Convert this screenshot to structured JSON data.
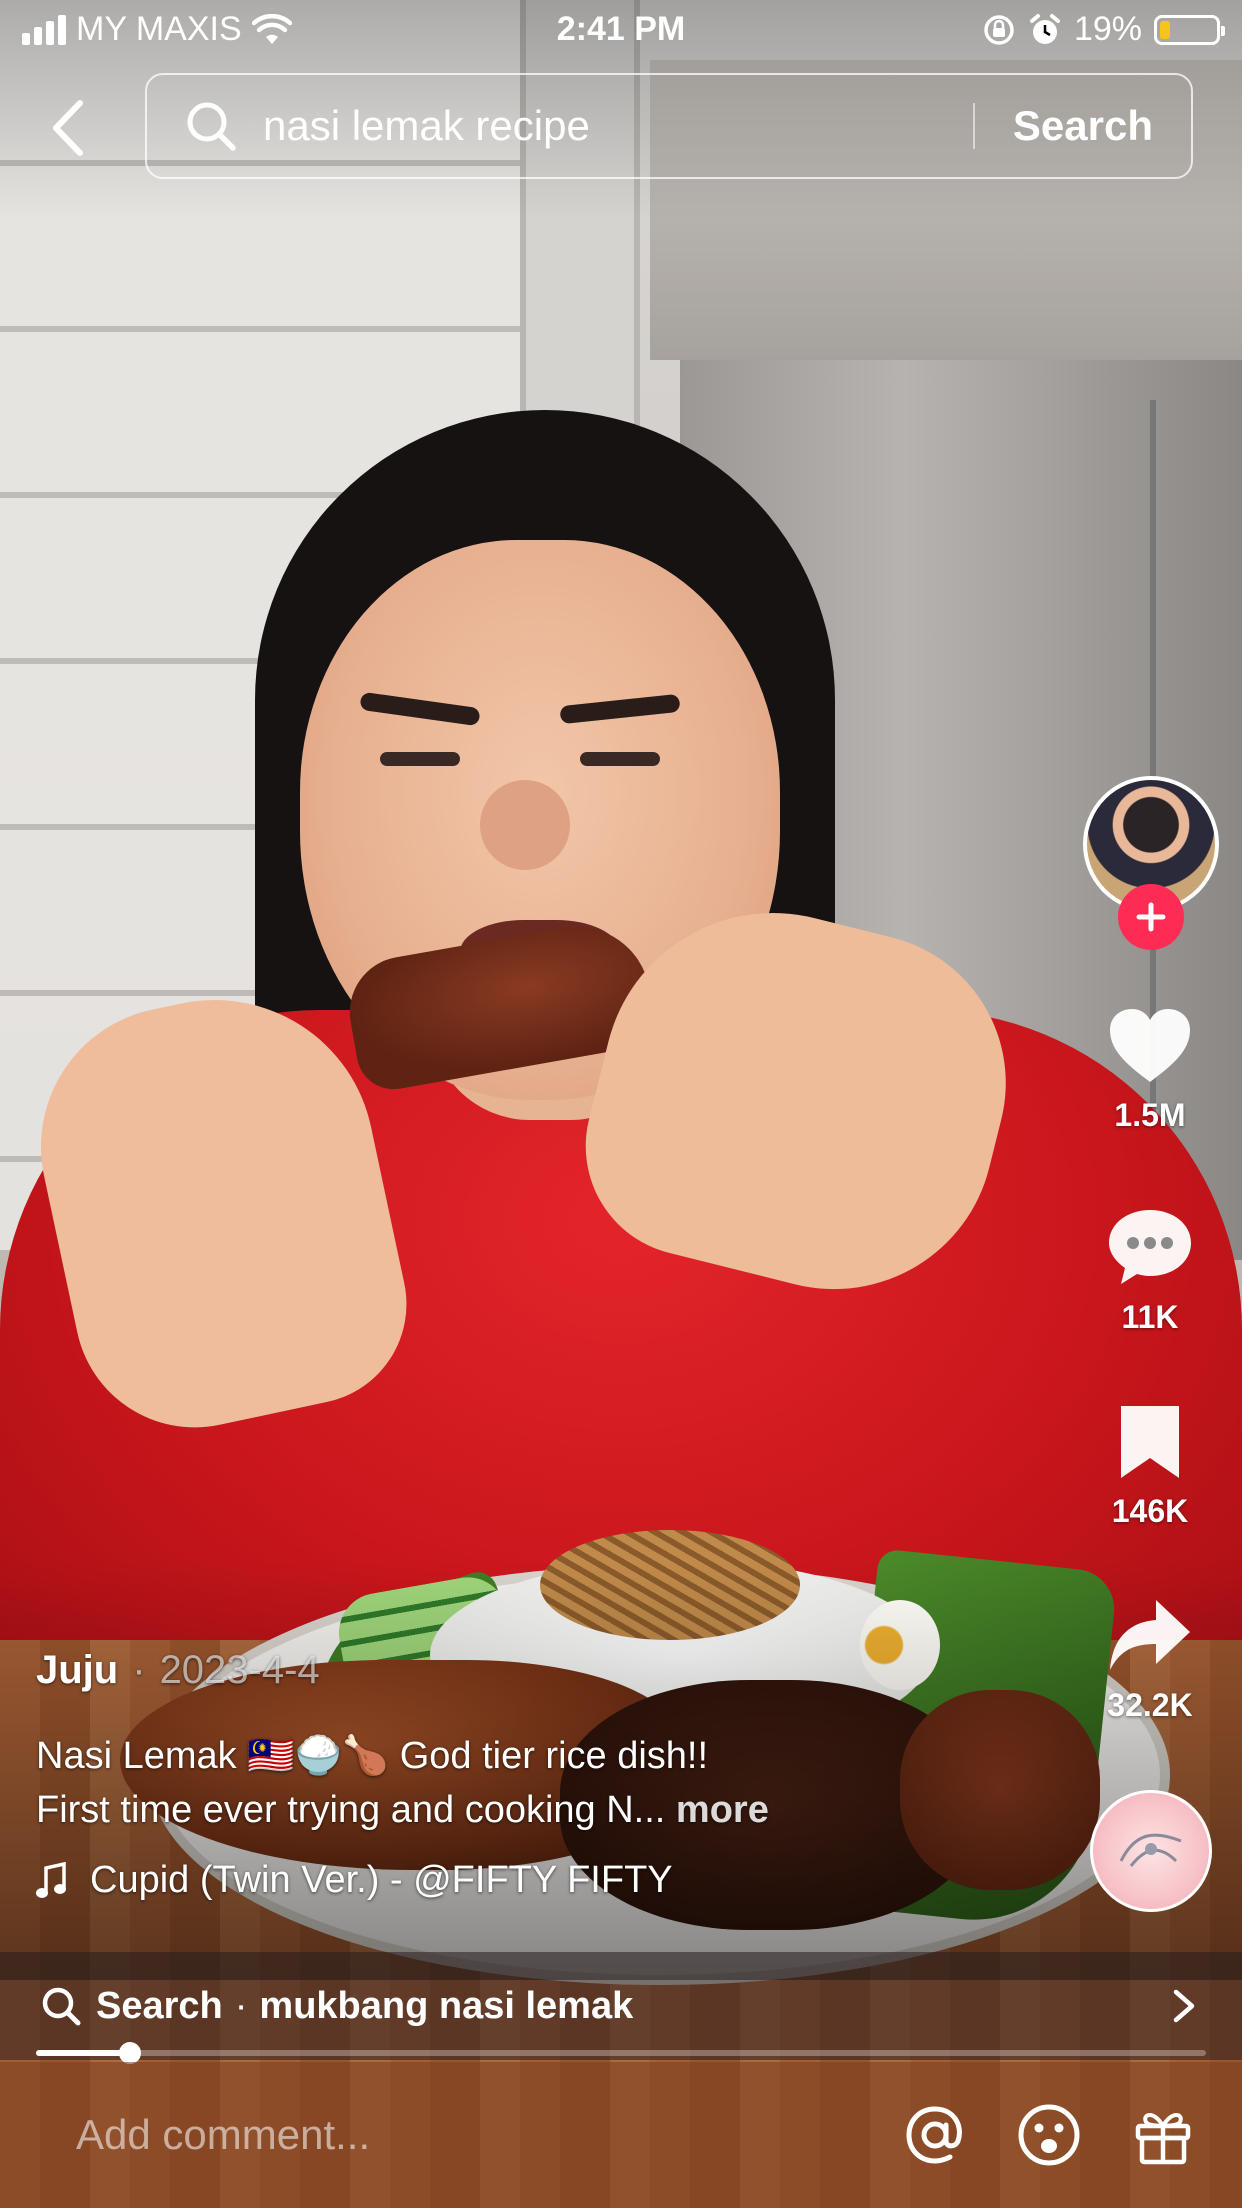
{
  "status_bar": {
    "carrier": "MY MAXIS",
    "time": "2:41 PM",
    "battery": "19%",
    "battery_level": 0.19,
    "battery_color": "#f5c518"
  },
  "search": {
    "query": "nasi lemak recipe",
    "button_label": "Search",
    "back_icon": "chevron-left-icon",
    "search_icon": "search-icon"
  },
  "actions": {
    "likes": "1.5M",
    "comments": "11K",
    "saves": "146K",
    "shares": "32.2K",
    "follow_color": "#fe2c55"
  },
  "post": {
    "author": "Juju",
    "date": "2023-4-4",
    "desc_line1": "Nasi Lemak 🇲🇾🍚🍗  God tier rice dish!!",
    "desc_line2": "First time ever trying and cooking N...",
    "more_label": "more",
    "music": "Cupid (Twin Ver.) - @FIFTY FIFTY"
  },
  "related_search": {
    "label": "Search",
    "separator": "·",
    "term": "mukbang nasi lemak"
  },
  "playback": {
    "progress": 0.08
  },
  "comment_bar": {
    "placeholder": "Add comment..."
  }
}
